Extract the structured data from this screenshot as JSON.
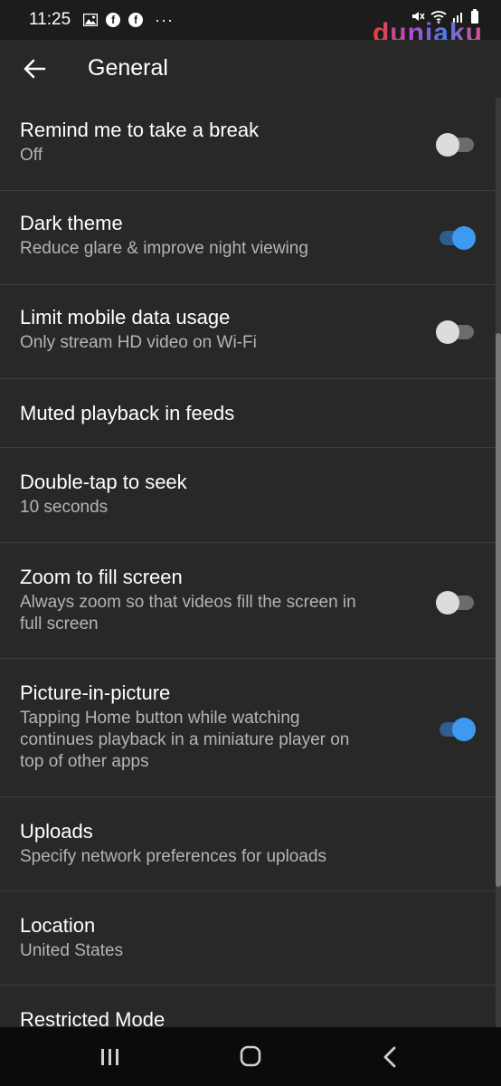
{
  "status_bar": {
    "time": "11:25",
    "more": "···",
    "fb_letter": "f"
  },
  "watermark": "duniaku",
  "header": {
    "title": "General"
  },
  "settings": [
    {
      "title": "Remind me to take a break",
      "subtitle": "Off",
      "toggle": "off"
    },
    {
      "title": "Dark theme",
      "subtitle": "Reduce glare & improve night viewing",
      "toggle": "on"
    },
    {
      "title": "Limit mobile data usage",
      "subtitle": "Only stream HD video on Wi-Fi",
      "toggle": "off"
    },
    {
      "title": "Muted playback in feeds",
      "subtitle": "",
      "toggle": "none"
    },
    {
      "title": "Double-tap to seek",
      "subtitle": "10 seconds",
      "toggle": "none"
    },
    {
      "title": "Zoom to fill screen",
      "subtitle_lines": [
        "Always zoom so that videos fill the screen in",
        "full screen"
      ],
      "toggle": "off"
    },
    {
      "title": "Picture-in-picture",
      "subtitle_lines": [
        "Tapping Home button while watching",
        "continues playback in a miniature player on",
        "top of other apps"
      ],
      "toggle": "on"
    },
    {
      "title": "Uploads",
      "subtitle": "Specify network preferences for uploads",
      "toggle": "none"
    },
    {
      "title": "Location",
      "subtitle": "United States",
      "toggle": "none"
    },
    {
      "title": "Restricted Mode",
      "subtitle": "",
      "toggle": "none"
    }
  ],
  "colors": {
    "background": "#282828",
    "accent": "#3d9af0",
    "secondary_text": "#b4b4b4"
  },
  "icons": [
    "image-icon",
    "facebook-icon",
    "mute-icon",
    "wifi-icon",
    "signal-icon",
    "battery-icon",
    "back-arrow-icon",
    "recent-apps-icon",
    "home-icon",
    "nav-back-icon"
  ]
}
